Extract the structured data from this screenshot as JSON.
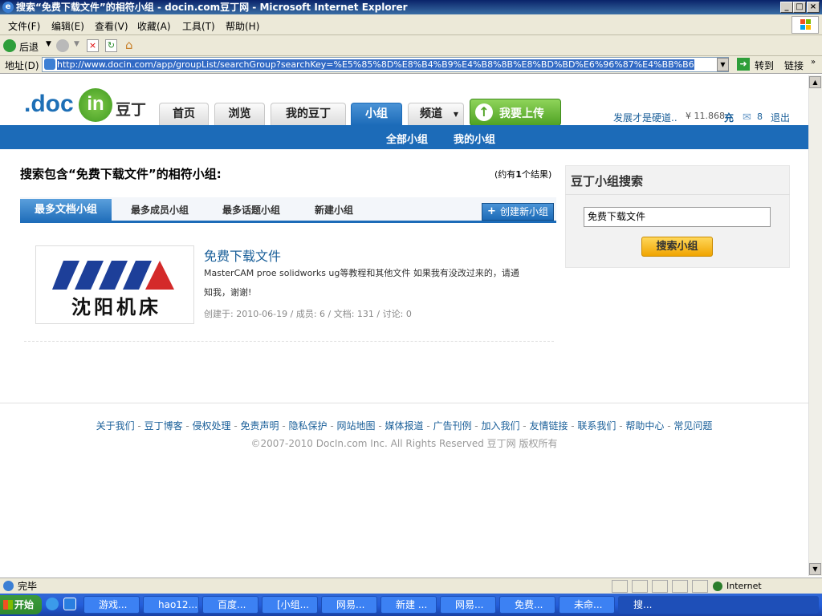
{
  "window": {
    "title": "搜索“免费下载文件”的相符小组 - docin.com豆丁网 - Microsoft Internet Explorer"
  },
  "menubar": {
    "items": [
      "文件(F)",
      "编辑(E)",
      "查看(V)",
      "收藏(A)",
      "工具(T)",
      "帮助(H)"
    ]
  },
  "toolbar": {
    "back_label": "后退"
  },
  "address": {
    "label": "地址(D)",
    "url": "http://www.docin.com/app/groupList/searchGroup?searchKey=%E5%85%8D%E8%B4%B9%E4%B8%8B%E8%BD%BD%E6%96%87%E4%BB%B6",
    "go_label": "转到",
    "links_label": "链接"
  },
  "site": {
    "logo_text": ".doc",
    "logo_in": "in",
    "logo_cn": "豆丁",
    "nav": [
      "首页",
      "浏览",
      "我的豆丁",
      "小组",
      "频道"
    ],
    "upload_label": "我要上传",
    "user_name": "发展才是硬道..",
    "balance": "¥ 11.868",
    "recharge": "充",
    "mail_count": "8",
    "logout": "退出",
    "subnav": [
      "全部小组",
      "我的小组"
    ]
  },
  "search": {
    "heading": "搜索包含“免费下载文件”的相符小组:",
    "result_count_prefix": "(约有",
    "result_count": "1",
    "result_count_suffix": "个结果)",
    "tabs": [
      "最多文档小组",
      "最多成员小组",
      "最多话题小组",
      "新建小组"
    ],
    "create_label": "创建新小组"
  },
  "result": {
    "title": "免费下载文件",
    "desc_line1": "MasterCAM proe solidworks ug等教程和其他文件 如果我有没改过来的，请通",
    "desc_line2": "知我，谢谢!",
    "meta": "创建于: 2010-06-19 / 成员: 6 / 文档: 131 / 讨论: 0",
    "logo_text": "沈阳机床"
  },
  "sidebar": {
    "title": "豆丁小组搜索",
    "input_value": "免费下载文件",
    "button_label": "搜索小组"
  },
  "footer": {
    "links": [
      "关于我们",
      "豆丁博客",
      "侵权处理",
      "免责声明",
      "隐私保护",
      "网站地图",
      "媒体报道",
      "广告刊例",
      "加入我们",
      "友情链接",
      "联系我们",
      "帮助中心",
      "常见问题"
    ],
    "copyright": "©2007-2010 DocIn.com Inc. All Rights Reserved 豆丁网 版权所有"
  },
  "statusbar": {
    "text": "完毕",
    "zone": "Internet"
  },
  "taskbar": {
    "start": "开始",
    "tasks": [
      "游戏...",
      "hao12...",
      "百度...",
      "[小组...",
      "网易...",
      "新建 ...",
      "网易...",
      "免费...",
      "未命...",
      "搜..."
    ]
  }
}
